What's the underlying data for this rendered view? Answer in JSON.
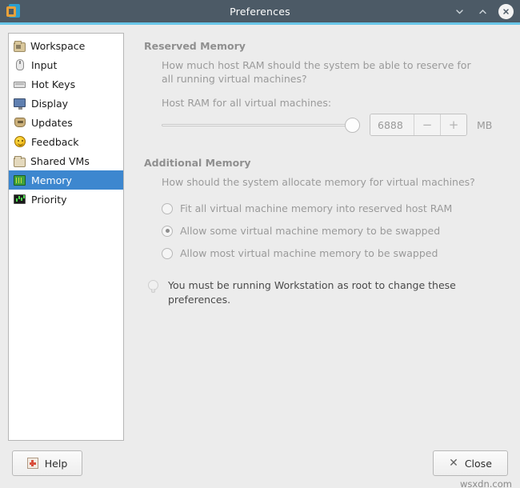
{
  "window": {
    "title": "Preferences",
    "app_icon": "vmware-workstation-icon",
    "minimize_glyph": "⌄",
    "maximize_glyph": "⌃",
    "close_glyph": "✕",
    "titlebar_color": "#4c5a66",
    "accent_color": "#69c6e8"
  },
  "sidebar": {
    "items": [
      {
        "label": "Workspace",
        "icon": "folder-icon",
        "selected": false
      },
      {
        "label": "Input",
        "icon": "mouse-icon",
        "selected": false
      },
      {
        "label": "Hot Keys",
        "icon": "keyboard-icon",
        "selected": false
      },
      {
        "label": "Display",
        "icon": "monitor-icon",
        "selected": false
      },
      {
        "label": "Updates",
        "icon": "updates-icon",
        "selected": false
      },
      {
        "label": "Feedback",
        "icon": "smiley-icon",
        "selected": false
      },
      {
        "label": "Shared VMs",
        "icon": "folder-icon",
        "selected": false
      },
      {
        "label": "Memory",
        "icon": "memory-chip-icon",
        "selected": true
      },
      {
        "label": "Priority",
        "icon": "priority-graph-icon",
        "selected": false
      }
    ],
    "selection_color": "#3d87cf"
  },
  "main": {
    "reserved_memory": {
      "heading": "Reserved Memory",
      "description": "How much host RAM should the system be able to reserve for all running virtual machines?",
      "slider_label": "Host RAM for all virtual machines:",
      "slider_position_percent": 100,
      "spin_value": "6888",
      "decrement_glyph": "−",
      "increment_glyph": "+",
      "unit": "MB"
    },
    "additional_memory": {
      "heading": "Additional Memory",
      "description": "How should the system allocate memory for virtual machines?",
      "options": [
        {
          "label": "Fit all virtual machine memory into reserved host RAM",
          "selected": false
        },
        {
          "label": "Allow some virtual machine memory to be swapped",
          "selected": true
        },
        {
          "label": "Allow most virtual machine memory to be swapped",
          "selected": false
        }
      ]
    },
    "tip": {
      "icon": "lightbulb-icon",
      "text": "You must be running Workstation as root to change these preferences."
    }
  },
  "footer": {
    "help_label": "Help",
    "help_icon": "help-icon",
    "close_label": "Close",
    "close_icon": "close-x-icon",
    "watermark": "wsxdn.com"
  }
}
